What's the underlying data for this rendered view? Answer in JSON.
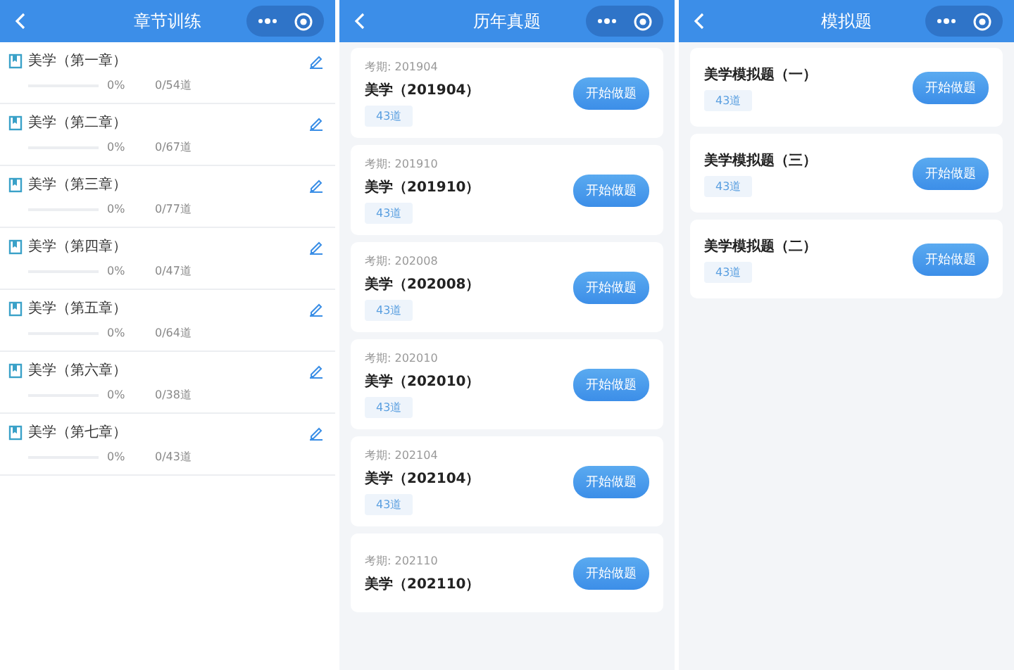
{
  "panels": [
    {
      "title": "章节训练",
      "kind": "chapters",
      "items": [
        {
          "name": "美学（第一章）",
          "level": 0,
          "percent": "0%",
          "count": "0/54道"
        },
        {
          "name": "美学（第二章）",
          "level": 0,
          "percent": "0%",
          "count": "0/67道"
        },
        {
          "name": "美学（第三章）",
          "level": 0,
          "percent": "0%",
          "count": "0/77道"
        },
        {
          "name": "美学（第四章）",
          "level": 0,
          "percent": "0%",
          "count": "0/47道"
        },
        {
          "name": "美学（第五章）",
          "level": 0,
          "percent": "0%",
          "count": "0/64道"
        },
        {
          "name": "美学（第六章）",
          "level": 0,
          "percent": "0%",
          "count": "0/38道"
        },
        {
          "name": "美学（第七章）",
          "level": 0,
          "percent": "0%",
          "count": "0/43道"
        }
      ]
    },
    {
      "title": "历年真题",
      "kind": "papers",
      "items": [
        {
          "period": "考期: 201904",
          "name": "美学（201904）",
          "tag": "43道",
          "button": "开始做题"
        },
        {
          "period": "考期: 201910",
          "name": "美学（201910）",
          "tag": "43道",
          "button": "开始做题"
        },
        {
          "period": "考期: 202008",
          "name": "美学（202008）",
          "tag": "43道",
          "button": "开始做题"
        },
        {
          "period": "考期: 202010",
          "name": "美学（202010）",
          "tag": "43道",
          "button": "开始做题"
        },
        {
          "period": "考期: 202104",
          "name": "美学（202104）",
          "tag": "43道",
          "button": "开始做题"
        },
        {
          "period": "考期: 202110",
          "name": "美学（202110）",
          "button": "开始做题"
        }
      ]
    },
    {
      "title": "模拟题",
      "kind": "papers",
      "items": [
        {
          "name": "美学模拟题（一）",
          "tag": "43道",
          "button": "开始做题"
        },
        {
          "name": "美学模拟题（三）",
          "tag": "43道",
          "button": "开始做题"
        },
        {
          "name": "美学模拟题（二）",
          "tag": "43道",
          "button": "开始做题"
        }
      ]
    }
  ]
}
